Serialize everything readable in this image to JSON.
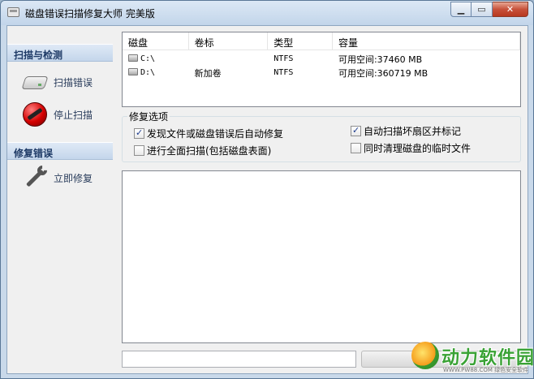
{
  "window": {
    "title": "磁盘错误扫描修复大师 完美版",
    "minimize_icon": "minimize-icon",
    "maximize_icon": "maximize-icon",
    "close_icon": "close-icon"
  },
  "sidebar": {
    "sections": [
      {
        "header": "扫描与检测",
        "items": [
          {
            "label": "扫描错误",
            "icon": "disk-icon"
          },
          {
            "label": "停止扫描",
            "icon": "stop-icon"
          }
        ]
      },
      {
        "header": "修复错误",
        "items": [
          {
            "label": "立即修复",
            "icon": "wrench-icon"
          }
        ]
      }
    ]
  },
  "disk_list": {
    "columns": [
      "磁盘",
      "卷标",
      "类型",
      "容量"
    ],
    "rows": [
      {
        "drive": "C:\\",
        "label": "",
        "type": "NTFS",
        "capacity": "可用空间:37460 MB"
      },
      {
        "drive": "D:\\",
        "label": "新加卷",
        "type": "NTFS",
        "capacity": "可用空间:360719 MB"
      }
    ]
  },
  "repair_options": {
    "title": "修复选项",
    "options": [
      {
        "label": "发现文件或磁盘错误后自动修复",
        "checked": true
      },
      {
        "label": "进行全面扫描(包括磁盘表面)",
        "checked": false
      },
      {
        "label": "自动扫描坏扇区并标记",
        "checked": true
      },
      {
        "label": "同时清理磁盘的临时文件",
        "checked": false
      }
    ]
  },
  "log": {
    "text": ""
  },
  "status": {
    "value": "",
    "progress": 0
  },
  "watermark": {
    "brand": "动力软件园",
    "url": "WWW.PW88.COM",
    "tagline": "绿色安全软件",
    "brand_color": "#39a234"
  }
}
